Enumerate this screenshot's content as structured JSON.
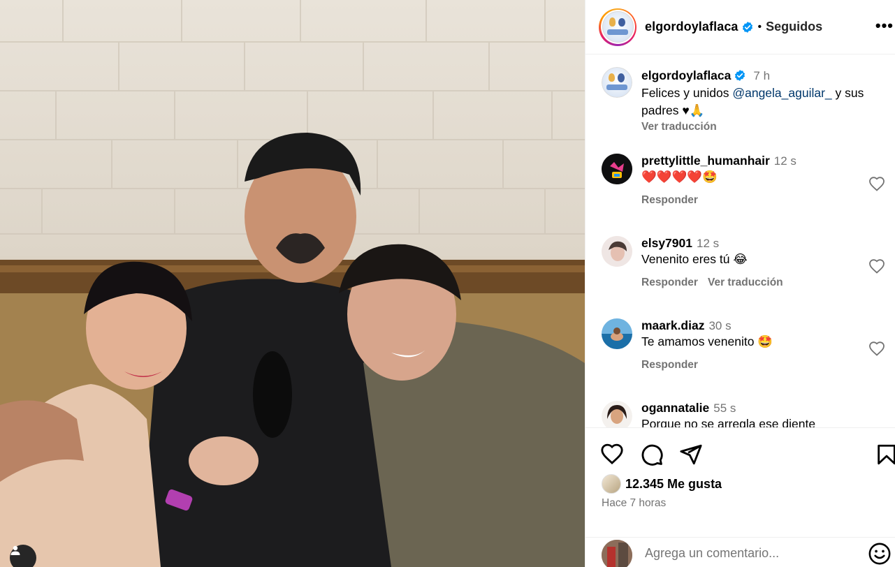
{
  "post": {
    "username": "elgordoylaflaca",
    "separator": "•",
    "follow_state": "Seguidos",
    "more": "•••"
  },
  "caption": {
    "username": "elgordoylaflaca",
    "time": "7 h",
    "text_before": "Felices y unidos ",
    "mention": "@angela_aguilar_",
    "text_after": " y sus padres ♥🙏",
    "translate": "Ver traducción"
  },
  "comments": [
    {
      "username": "prettylittle_humanhair",
      "time": "12 s",
      "text": "❤️❤️❤️❤️🤩",
      "reply": "Responder",
      "translate": ""
    },
    {
      "username": "elsy7901",
      "time": "12 s",
      "text": "Venenito eres tú 😂",
      "reply": "Responder",
      "translate": "Ver traducción"
    },
    {
      "username": "maark.diaz",
      "time": "30 s",
      "text": "Te amamos venenito 🤩",
      "reply": "Responder",
      "translate": ""
    },
    {
      "username": "ogannatalie",
      "time": "55 s",
      "text": "Porque no se arregla ese diente",
      "reply": "",
      "translate": ""
    }
  ],
  "stats": {
    "likes": "12.345 Me gusta",
    "posted": "Hace 7 horas"
  },
  "composer": {
    "placeholder": "Agrega un comentario..."
  },
  "icons": {
    "verified": "verified-badge-icon",
    "like": "heart-icon",
    "comment": "comment-icon",
    "share": "share-icon",
    "save": "bookmark-icon",
    "emoji": "emoji-icon",
    "tagged": "user-tag-icon",
    "more": "more-icon"
  },
  "colors": {
    "verified": "#0095f6",
    "mention": "#00376b",
    "secondary_text": "#737373",
    "divider": "#efefef"
  }
}
